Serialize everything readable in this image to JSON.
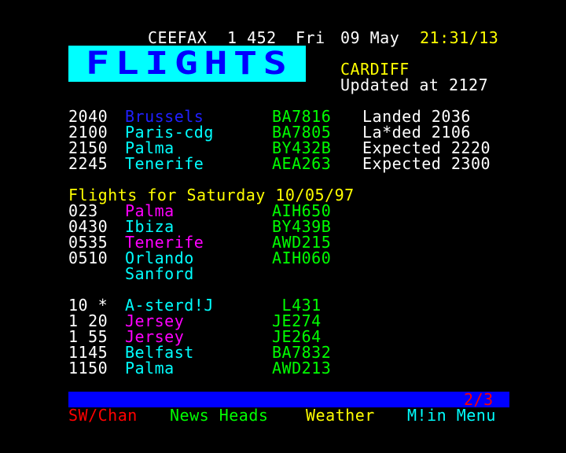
{
  "header": {
    "service": "CEEFAX",
    "page": "1 452",
    "day": "Fri",
    "date": "09 May",
    "time": "21:31/13"
  },
  "banner": {
    "title": "FLIGHTS"
  },
  "location": {
    "city": "CARDIFF",
    "updated": "Updated at 2127"
  },
  "arrivals": [
    {
      "time": "2040",
      "dest": "Brussels",
      "flight": "BA7816",
      "status": "Landed 2036"
    },
    {
      "time": "2100",
      "dest": "Paris-cdg",
      "flight": "BA7805",
      "status": "La*ded 2106"
    },
    {
      "time": "2150",
      "dest": "Palma",
      "flight": "BY432B",
      "status": "Expected 2220"
    },
    {
      "time": "2245",
      "dest": "Tenerife",
      "flight": "AEA263",
      "status": "Expected 2300"
    }
  ],
  "saturday": {
    "heading": "Flights for Saturday 10/05/97",
    "rows": [
      {
        "time": "023",
        "dest": "Palma",
        "flight": "AIH650"
      },
      {
        "time": "0430",
        "dest": "Ibiza",
        "flight": "BY439B"
      },
      {
        "time": "0535",
        "dest": "Tenerife",
        "flight": "AWD215"
      },
      {
        "time": "0510",
        "dest": "Orlando",
        "flight": "AIH060"
      },
      {
        "time": "",
        "dest": "Sanford",
        "flight": ""
      },
      {
        "time": "",
        "dest": "",
        "flight": ""
      },
      {
        "time": "10 *",
        "dest": "A-sterd!J",
        "flight": " L431"
      },
      {
        "time": "1 20",
        "dest": "Jersey",
        "flight": "JE274"
      },
      {
        "time": "1 55",
        "dest": "Jersey",
        "flight": "JE264"
      },
      {
        "time": "1145",
        "dest": "Belfast",
        "flight": "BA7832"
      },
      {
        "time": "1150",
        "dest": "Palma",
        "flight": "AWD213"
      }
    ]
  },
  "pager": "2/3",
  "fastext": {
    "red": "SW/Chan",
    "green": "News Heads",
    "yellow": "Weather",
    "cyan": "M!in Menu"
  },
  "colors": {
    "background": "#000000",
    "banner": "#00ffff",
    "banner_text": "#0000ff",
    "bar": "#0000ff"
  }
}
